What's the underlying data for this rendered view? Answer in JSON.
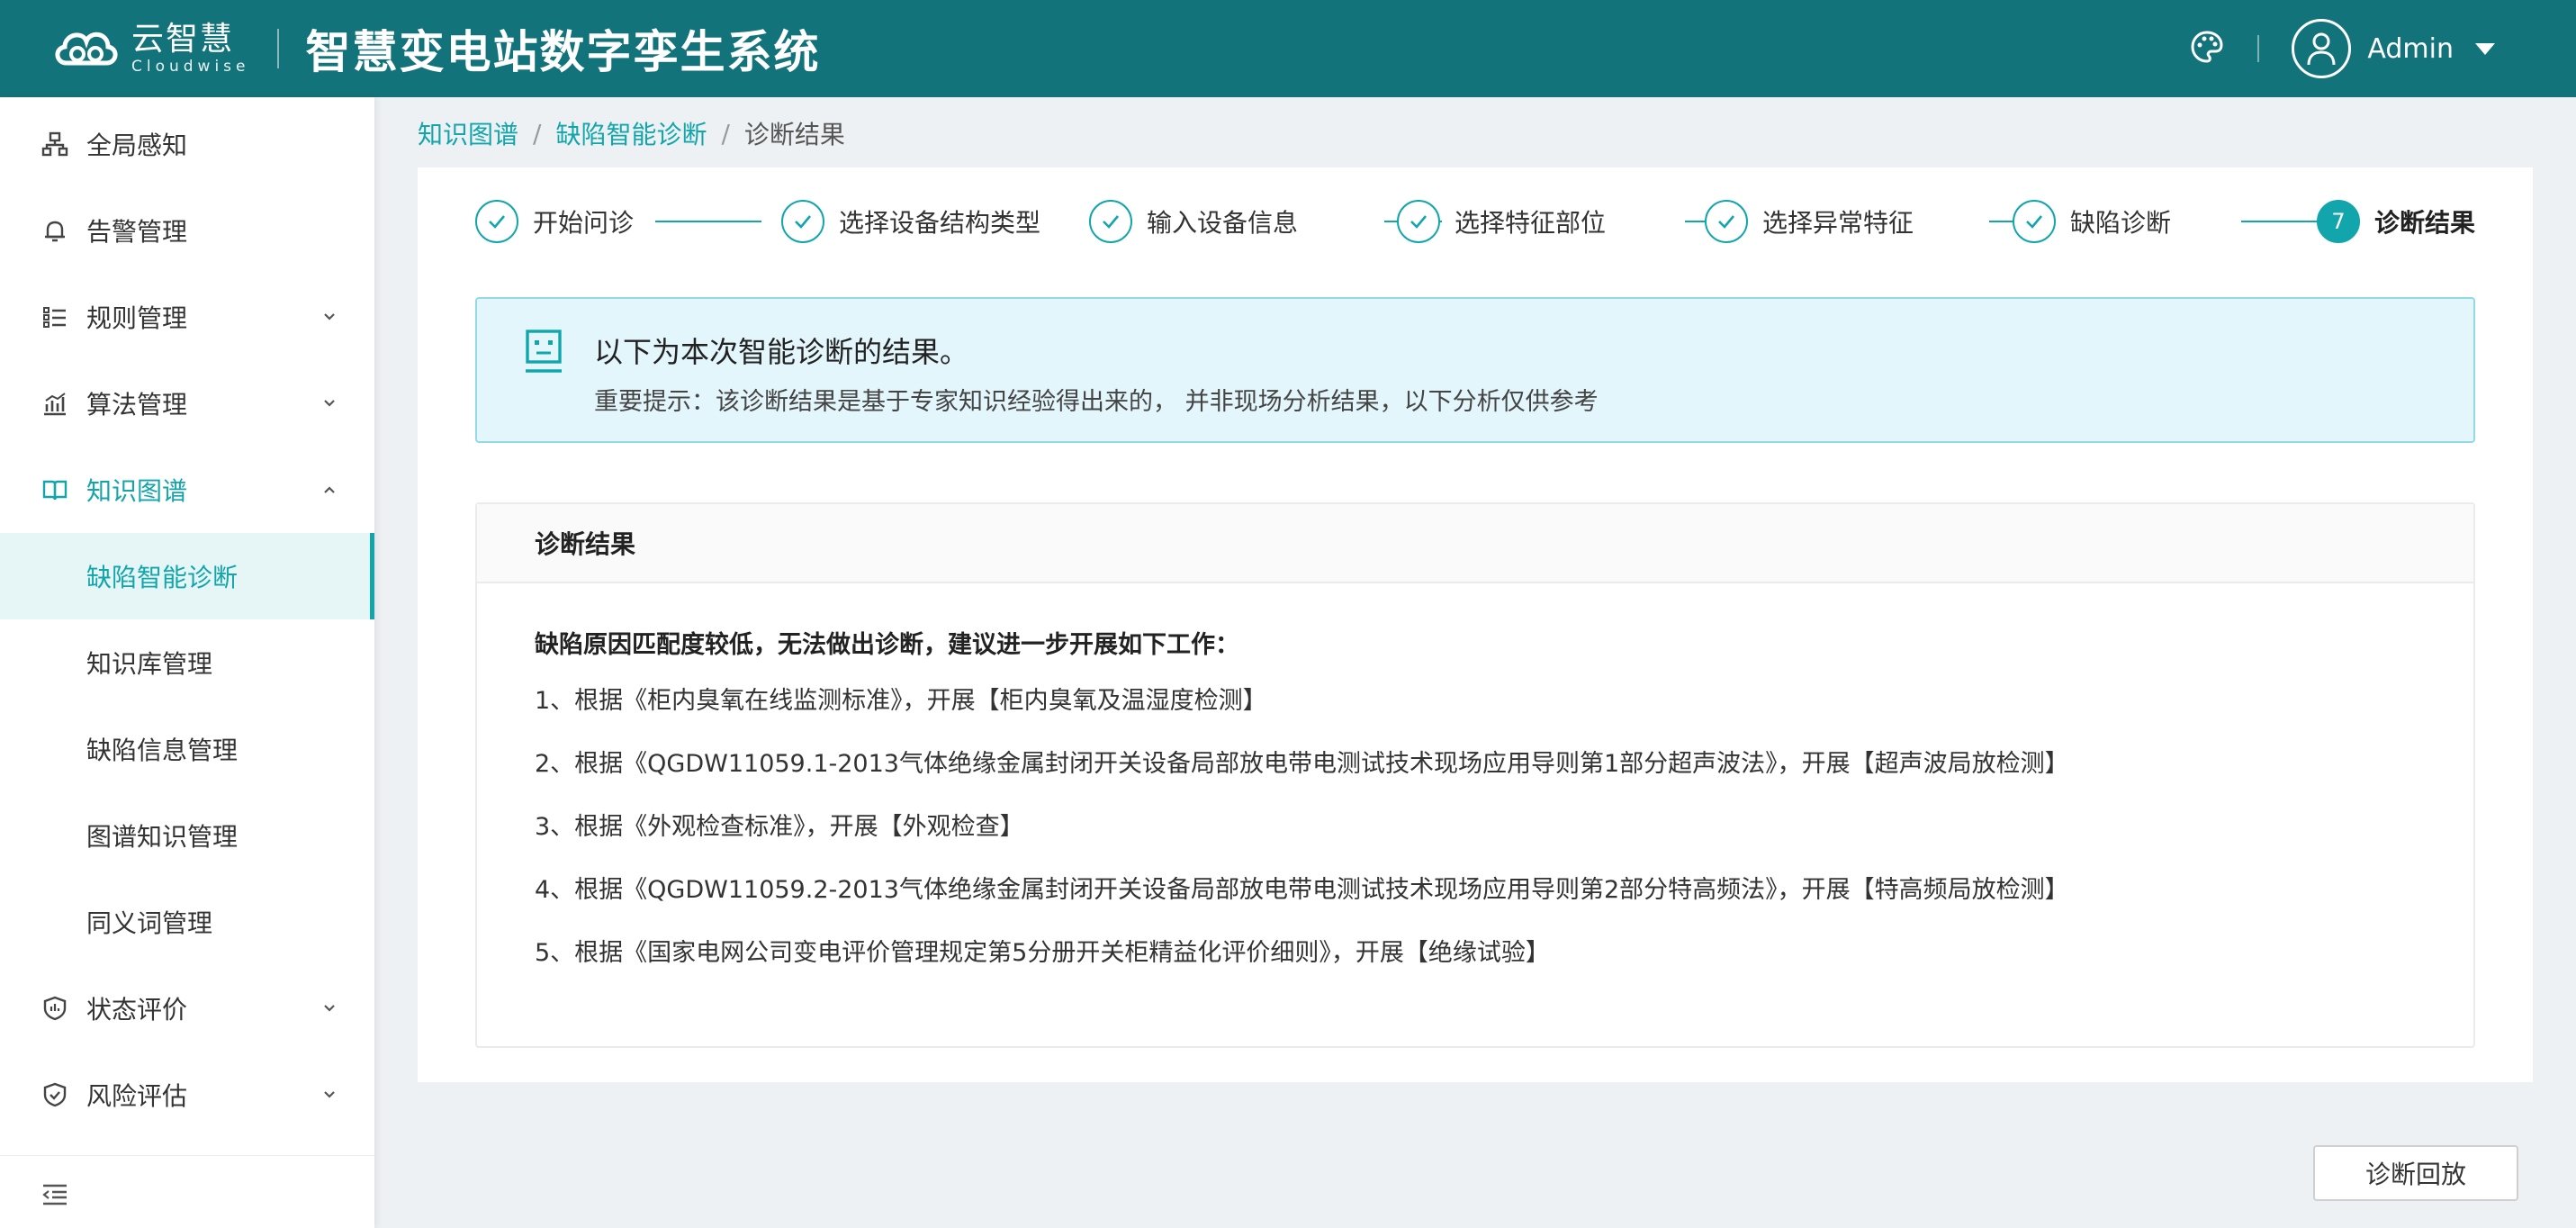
{
  "header": {
    "logo_cn": "云智慧",
    "logo_en": "Cloudwise",
    "app_title": "智慧变电站数字孪生系统",
    "user_name": "Admin"
  },
  "sidebar": {
    "items": [
      {
        "label": "全局感知",
        "icon": "network-icon"
      },
      {
        "label": "告警管理",
        "icon": "bell-icon"
      },
      {
        "label": "规则管理",
        "icon": "list-icon"
      },
      {
        "label": "算法管理",
        "icon": "chart-icon"
      },
      {
        "label": "知识图谱",
        "icon": "book-icon"
      },
      {
        "label": "缺陷智能诊断"
      },
      {
        "label": "知识库管理"
      },
      {
        "label": "缺陷信息管理"
      },
      {
        "label": "图谱知识管理"
      },
      {
        "label": "同义词管理"
      },
      {
        "label": "状态评价",
        "icon": "shield-icon"
      },
      {
        "label": "风险评估",
        "icon": "shield-check-icon"
      }
    ]
  },
  "breadcrumb": {
    "items": [
      "知识图谱",
      "缺陷智能诊断",
      "诊断结果"
    ]
  },
  "steps": {
    "items": [
      {
        "label": "开始问诊"
      },
      {
        "label": "选择设备结构类型"
      },
      {
        "label": "输入设备信息"
      },
      {
        "label": "选择特征部位"
      },
      {
        "label": "选择异常特征"
      },
      {
        "label": "缺陷诊断"
      },
      {
        "label": "诊断结果",
        "number": "7"
      }
    ]
  },
  "notice": {
    "title": "以下为本次智能诊断的结果。",
    "text": "重要提示：该诊断结果是基于专家知识经验得出来的， 并非现场分析结果，以下分析仅供参考"
  },
  "result": {
    "title": "诊断结果",
    "summary": "缺陷原因匹配度较低，无法做出诊断，建议进一步开展如下工作：",
    "lines": [
      "1、根据《柜内臭氧在线监测标准》，开展【柜内臭氧及温湿度检测】",
      "2、根据《QGDW11059.1-2013气体绝缘金属封闭开关设备局部放电带电测试技术现场应用导则第1部分超声波法》，开展【超声波局放检测】",
      "3、根据《外观检查标准》，开展【外观检查】",
      "4、根据《QGDW11059.2-2013气体绝缘金属封闭开关设备局部放电带电测试技术现场应用导则第2部分特高频法》，开展【特高频局放检测】",
      "5、根据《国家电网公司变电评价管理规定第5分册开关柜精益化评价细则》，开展【绝缘试验】"
    ]
  },
  "footer": {
    "replay_label": "诊断回放"
  },
  "colors": {
    "header_bg": "#13737a",
    "accent": "#13a5ac",
    "notice_bg": "#e3f6fb"
  }
}
